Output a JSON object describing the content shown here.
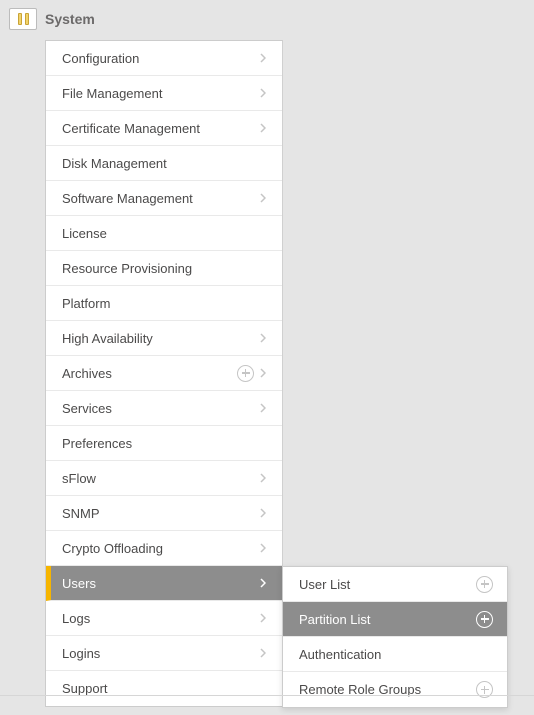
{
  "header": {
    "title": "System"
  },
  "menu": {
    "items": [
      {
        "label": "Configuration",
        "hasSubmenu": true
      },
      {
        "label": "File Management",
        "hasSubmenu": true
      },
      {
        "label": "Certificate Management",
        "hasSubmenu": true
      },
      {
        "label": "Disk Management"
      },
      {
        "label": "Software Management",
        "hasSubmenu": true
      },
      {
        "label": "License"
      },
      {
        "label": "Resource Provisioning"
      },
      {
        "label": "Platform"
      },
      {
        "label": "High Availability",
        "hasSubmenu": true
      },
      {
        "label": "Archives",
        "hasSubmenu": true,
        "hasAdd": true
      },
      {
        "label": "Services",
        "hasSubmenu": true
      },
      {
        "label": "Preferences"
      },
      {
        "label": "sFlow",
        "hasSubmenu": true
      },
      {
        "label": "SNMP",
        "hasSubmenu": true
      },
      {
        "label": "Crypto Offloading",
        "hasSubmenu": true
      },
      {
        "label": "Users",
        "hasSubmenu": true,
        "selected": true
      },
      {
        "label": "Logs",
        "hasSubmenu": true
      },
      {
        "label": "Logins",
        "hasSubmenu": true
      },
      {
        "label": "Support"
      }
    ]
  },
  "submenu": {
    "items": [
      {
        "label": "User List",
        "hasAdd": true
      },
      {
        "label": "Partition List",
        "hasAdd": true,
        "selected": true
      },
      {
        "label": "Authentication"
      },
      {
        "label": "Remote Role Groups",
        "hasAdd": true
      }
    ]
  }
}
